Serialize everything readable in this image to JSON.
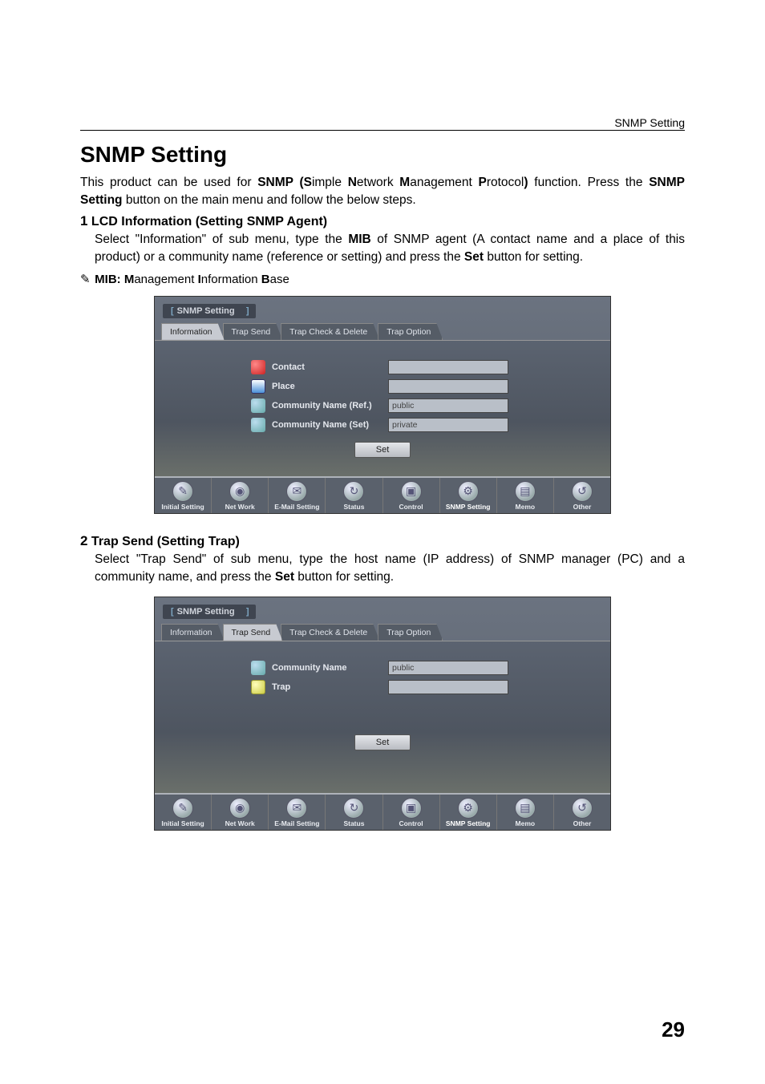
{
  "header_right": "SNMP Setting",
  "page_title": "SNMP Setting",
  "intro_parts": {
    "p1": "This product can be used for ",
    "b1": "SNMP (S",
    "p2": "imple ",
    "b2": "N",
    "p3": "etwork ",
    "b3": "M",
    "p4": "anagement ",
    "b4": "P",
    "p5": "rotocol",
    "b5": ")",
    "p6": " function. Press the ",
    "b6": "SNMP Setting",
    "p7": " button on the main menu and follow the below steps."
  },
  "section1": {
    "num": "1",
    "title_bold": "LCD Information",
    "title_rest": " (Setting SNMP Agent)",
    "body_p1": "Select \"Information\" of sub menu, type the ",
    "body_b1": "MIB",
    "body_p2": " of SNMP agent (A contact name and a place of this product) or a community name (reference or setting) and press the ",
    "body_b2": "Set",
    "body_p3": " button for setting."
  },
  "note": {
    "sym": "✎",
    "b1": "MIB: M",
    "p1": "anagement ",
    "b2": "I",
    "p2": "nformation ",
    "b3": "B",
    "p3": "ase"
  },
  "screenshot_common": {
    "title": "SNMP Setting",
    "tabs": [
      "Information",
      "Trap Send",
      "Trap Check & Delete",
      "Trap Option"
    ],
    "set_btn": "Set",
    "footer": [
      "Initial Setting",
      "Net Work",
      "E-Mail Setting",
      "Status",
      "Control",
      "SNMP Setting",
      "Memo",
      "Other"
    ]
  },
  "ss1": {
    "active_tab": 0,
    "rows": [
      {
        "icon": "ic-red",
        "label": "Contact",
        "value": ""
      },
      {
        "icon": "ic-blue",
        "label": "Place",
        "value": ""
      },
      {
        "icon": "ic-teal",
        "label": "Community Name (Ref.)",
        "value": "public"
      },
      {
        "icon": "ic-teal",
        "label": "Community Name (Set)",
        "value": "private"
      }
    ]
  },
  "section2": {
    "num": "2",
    "title_bold": "Trap Send",
    "title_rest": " (Setting Trap)",
    "body_p1": "Select \"Trap Send\" of sub menu, type the host name (IP address) of SNMP manager (PC) and a community name, and press the ",
    "body_b1": "Set",
    "body_p2": " button for setting."
  },
  "ss2": {
    "active_tab": 1,
    "rows": [
      {
        "icon": "ic-teal",
        "label": "Community Name",
        "value": "public"
      },
      {
        "icon": "ic-yellow",
        "label": "Trap",
        "value": ""
      }
    ]
  },
  "page_number": "29"
}
